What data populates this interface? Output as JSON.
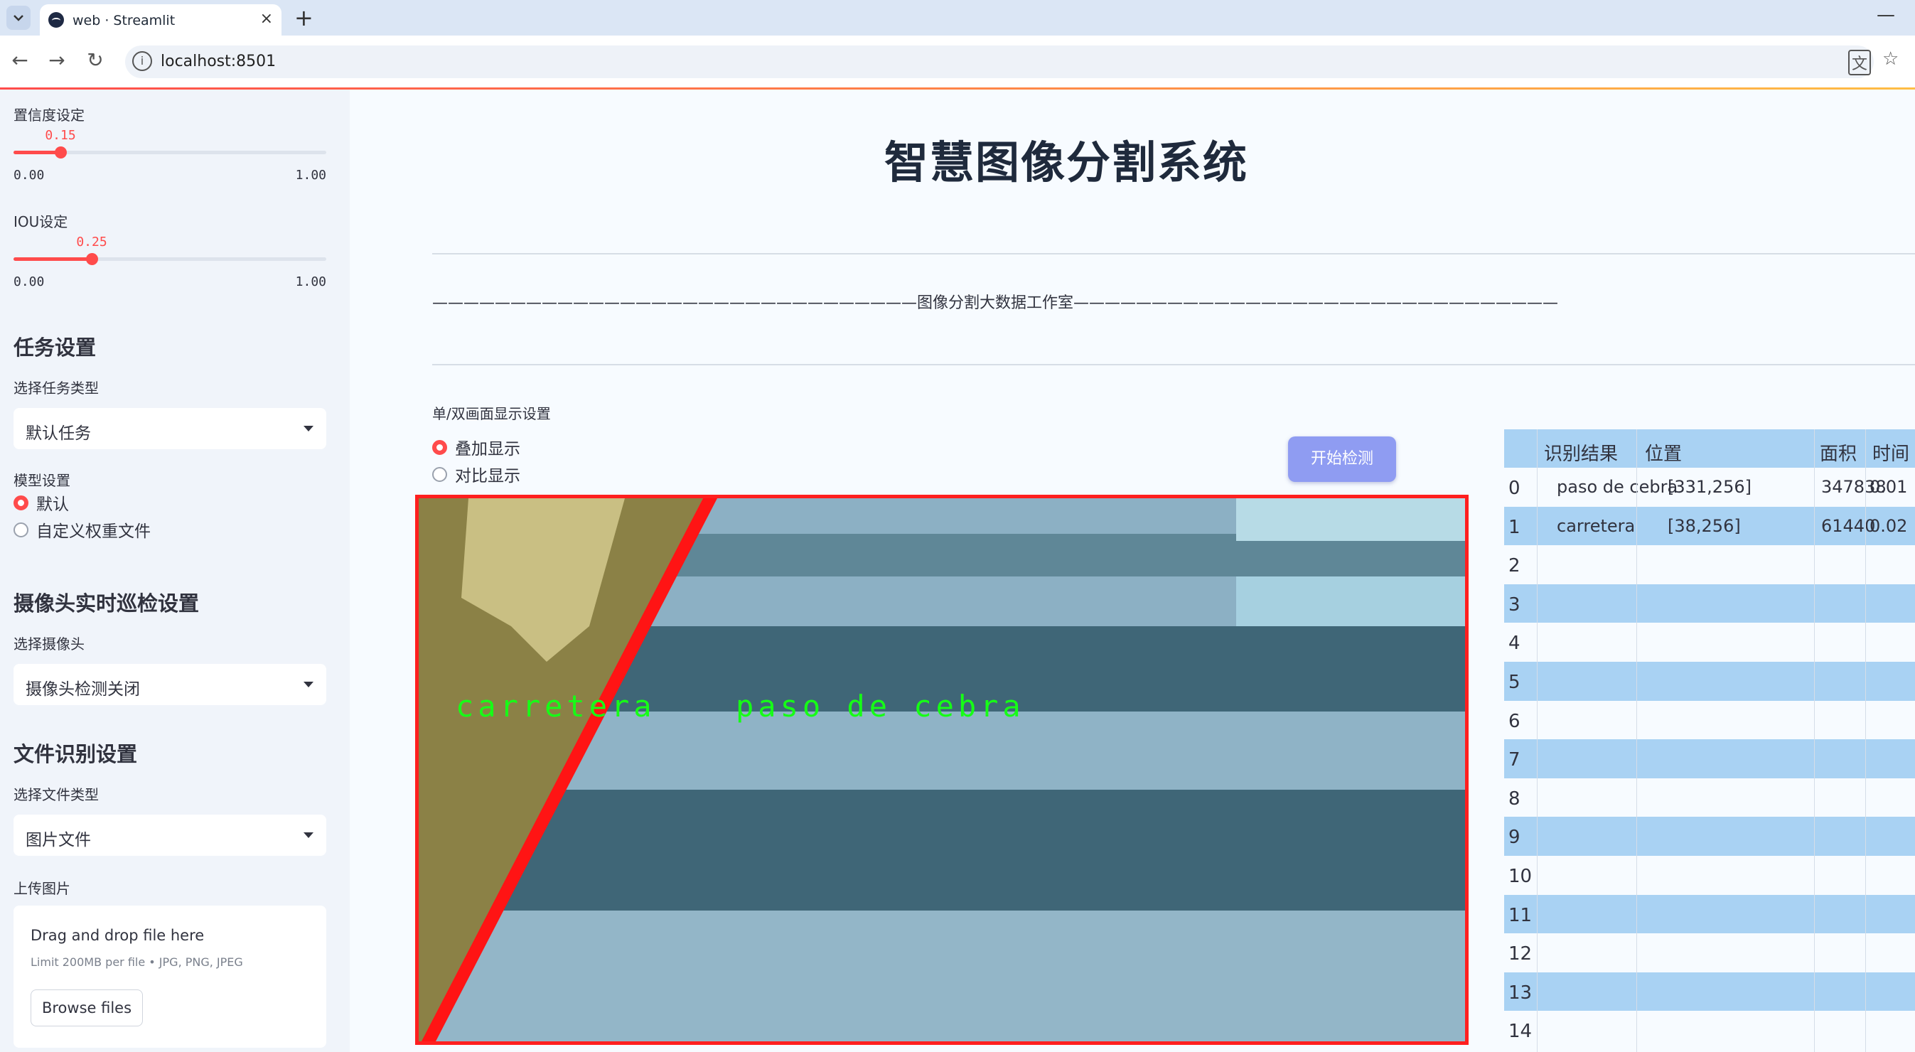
{
  "browser": {
    "tab_title": "web · Streamlit",
    "tab_close": "×",
    "new_tab": "+",
    "minimize": "—",
    "url": "localhost:8501",
    "back": "←",
    "forward": "→",
    "reload": "↻",
    "translate_icon": "文",
    "bookmark_icon": "☆"
  },
  "sidebar": {
    "confidence": {
      "label": "置信度设定",
      "value": 0.15,
      "value_text": "0.15",
      "min": "0.00",
      "max": "1.00"
    },
    "iou": {
      "label": "IOU设定",
      "value": 0.25,
      "value_text": "0.25",
      "min": "0.00",
      "max": "1.00"
    },
    "task_section": "任务设置",
    "task_type_label": "选择任务类型",
    "task_type_value": "默认任务",
    "model_label": "模型设置",
    "model_options": [
      "默认",
      "自定义权重文件"
    ],
    "model_selected": 0,
    "camera_section": "摄像头实时巡检设置",
    "camera_label": "选择摄像头",
    "camera_value": "摄像头检测关闭",
    "file_section": "文件识别设置",
    "file_type_label": "选择文件类型",
    "file_type_value": "图片文件",
    "upload_label": "上传图片",
    "upload_main": "Drag and drop file here",
    "upload_sub": "Limit 200MB per file • JPG, PNG, JPEG",
    "upload_button": "Browse files"
  },
  "main": {
    "title": "智慧图像分割系统",
    "banner": "———————————————————————————————图像分割大数据工作室———————————————————————————————",
    "display_mode_label": "单/双画面显示设置",
    "display_options": [
      "叠加显示",
      "对比显示"
    ],
    "display_selected": 0,
    "start_button": "开始检测",
    "detections": [
      "carretera",
      "paso de cebra"
    ]
  },
  "results_table": {
    "headers": [
      "识别结果",
      "位置",
      "面积",
      "时间"
    ],
    "rows": [
      {
        "index": "0",
        "result": "paso de cebra",
        "position": "[331,256]",
        "area": "347838",
        "time": "0.01"
      },
      {
        "index": "1",
        "result": "carretera",
        "position": "[38,256]",
        "area": "61440",
        "time": "0.02"
      },
      {
        "index": "2"
      },
      {
        "index": "3"
      },
      {
        "index": "4"
      },
      {
        "index": "5"
      },
      {
        "index": "6"
      },
      {
        "index": "7"
      },
      {
        "index": "8"
      },
      {
        "index": "9"
      },
      {
        "index": "10"
      },
      {
        "index": "11"
      },
      {
        "index": "12"
      },
      {
        "index": "13"
      },
      {
        "index": "14"
      }
    ]
  },
  "colors": {
    "accent": "#ff4b4b",
    "button": "#8f9cf2",
    "table_header": "#a9d2f3",
    "detection_text": "#16ff16"
  }
}
